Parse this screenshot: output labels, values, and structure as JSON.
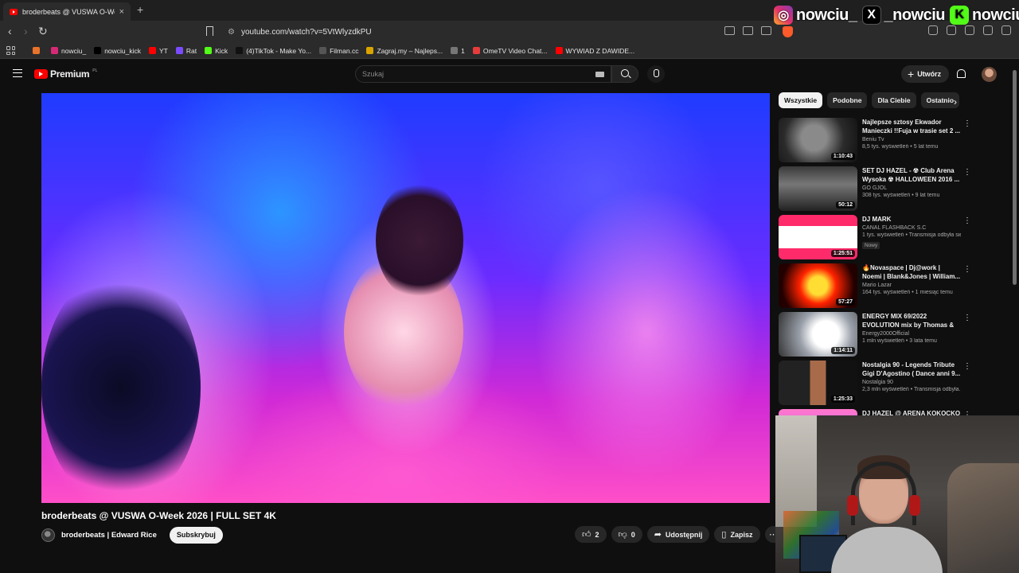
{
  "browser": {
    "tab_title": "broderbeats @ VUSWA O-Week",
    "tab_close": "×",
    "new_tab": "+",
    "url": "youtube.com/watch?v=5VtWlyzdkPU"
  },
  "overlay": {
    "socials": [
      {
        "platform": "instagram",
        "handle": "nowciu_"
      },
      {
        "platform": "x",
        "handle": "_nowciu"
      },
      {
        "platform": "kick",
        "handle": "nowciu"
      }
    ]
  },
  "bookmarks": [
    {
      "label": "",
      "color": "#e8732a",
      "icon": "folder-icon"
    },
    {
      "label": "nowciu_",
      "color": "#d62976",
      "icon": "instagram-icon"
    },
    {
      "label": "nowciu_kick",
      "color": "#000000",
      "icon": "x-icon"
    },
    {
      "label": "YT",
      "color": "#ff0000",
      "icon": "youtube-icon"
    },
    {
      "label": "Rat",
      "color": "#7b4cff",
      "icon": "twitch-icon"
    },
    {
      "label": "Kick",
      "color": "#53fc18",
      "icon": "kick-icon"
    },
    {
      "label": "(4)TikTok - Make Yo...",
      "color": "#111111",
      "icon": "tiktok-icon"
    },
    {
      "label": "Filman.cc",
      "color": "#555555",
      "icon": "filman-icon"
    },
    {
      "label": "Zagraj.my – Najleps...",
      "color": "#d9a400",
      "icon": "zagraj-icon"
    },
    {
      "label": "1",
      "color": "#777777",
      "icon": "globe-icon"
    },
    {
      "label": "OmeTV Video Chat...",
      "color": "#e63c3c",
      "icon": "ometv-icon"
    },
    {
      "label": "WYWIAD Z DAWIDE...",
      "color": "#ff0000",
      "icon": "youtube-icon"
    }
  ],
  "youtube": {
    "brand": "Premium",
    "region": "PL",
    "search_placeholder": "Szukaj",
    "create_label": "Utwórz",
    "video": {
      "title": "broderbeats @ VUSWA O-Week 2026 | FULL SET 4K",
      "channel": "broderbeats | Edward Rice",
      "subscribe_label": "Subskrybuj",
      "likes": "2",
      "dislikes": "0",
      "share_label": "Udostępnij",
      "save_label": "Zapisz"
    },
    "chips": [
      "Wszystkie",
      "Podobne",
      "Dla Ciebie",
      "Ostatnio"
    ],
    "recommendations": [
      {
        "title": "Najlepsze sztosy Ekwador Manieczki !!Fuja w trasie set 2 ...",
        "channel": "Beniu Tv",
        "stats": "8,5 tys. wyświetleń • 5 lat temu",
        "duration": "1:10:43",
        "badge": ""
      },
      {
        "title": "SET DJ HAZEL - ☢ Club Arena Wysoka ☢ HALLOWEEN 2016 ...",
        "channel": "GO GJOL",
        "stats": "308 tys. wyświetleń • 9 lat temu",
        "duration": "50:12",
        "badge": ""
      },
      {
        "title": "DJ MARK",
        "channel": "CANAL FLASHBACK S.C",
        "stats": "1 tys. wyświetleń • Transmisja odbyła się...",
        "duration": "1:25:51",
        "badge": "Nowy"
      },
      {
        "title": "🔥Novaspace | Dj@work | Noemi | Blank&Jones | William...",
        "channel": "Mario Lazar",
        "stats": "164 tys. wyświetleń • 1 miesiąc temu",
        "duration": "57:27",
        "badge": ""
      },
      {
        "title": "ENERGY MIX 69/2022 EVOLUTION mix by Thomas & ...",
        "channel": "Energy2000Official",
        "stats": "1 mln wyświetleń • 3 lata temu",
        "duration": "1:14:11",
        "badge": ""
      },
      {
        "title": "Nostalgia 90 - Legends Tribute Gigi D'Agostino ( Dance anni 9...",
        "channel": "Nostalgia 90",
        "stats": "2,3 mln wyświetleń • Transmisja odbyła...",
        "duration": "1:25:33",
        "badge": ""
      },
      {
        "title": "DJ HAZEL @ ARENA KOKOCKO",
        "channel": "",
        "stats": "",
        "duration": "",
        "badge": ""
      }
    ]
  }
}
